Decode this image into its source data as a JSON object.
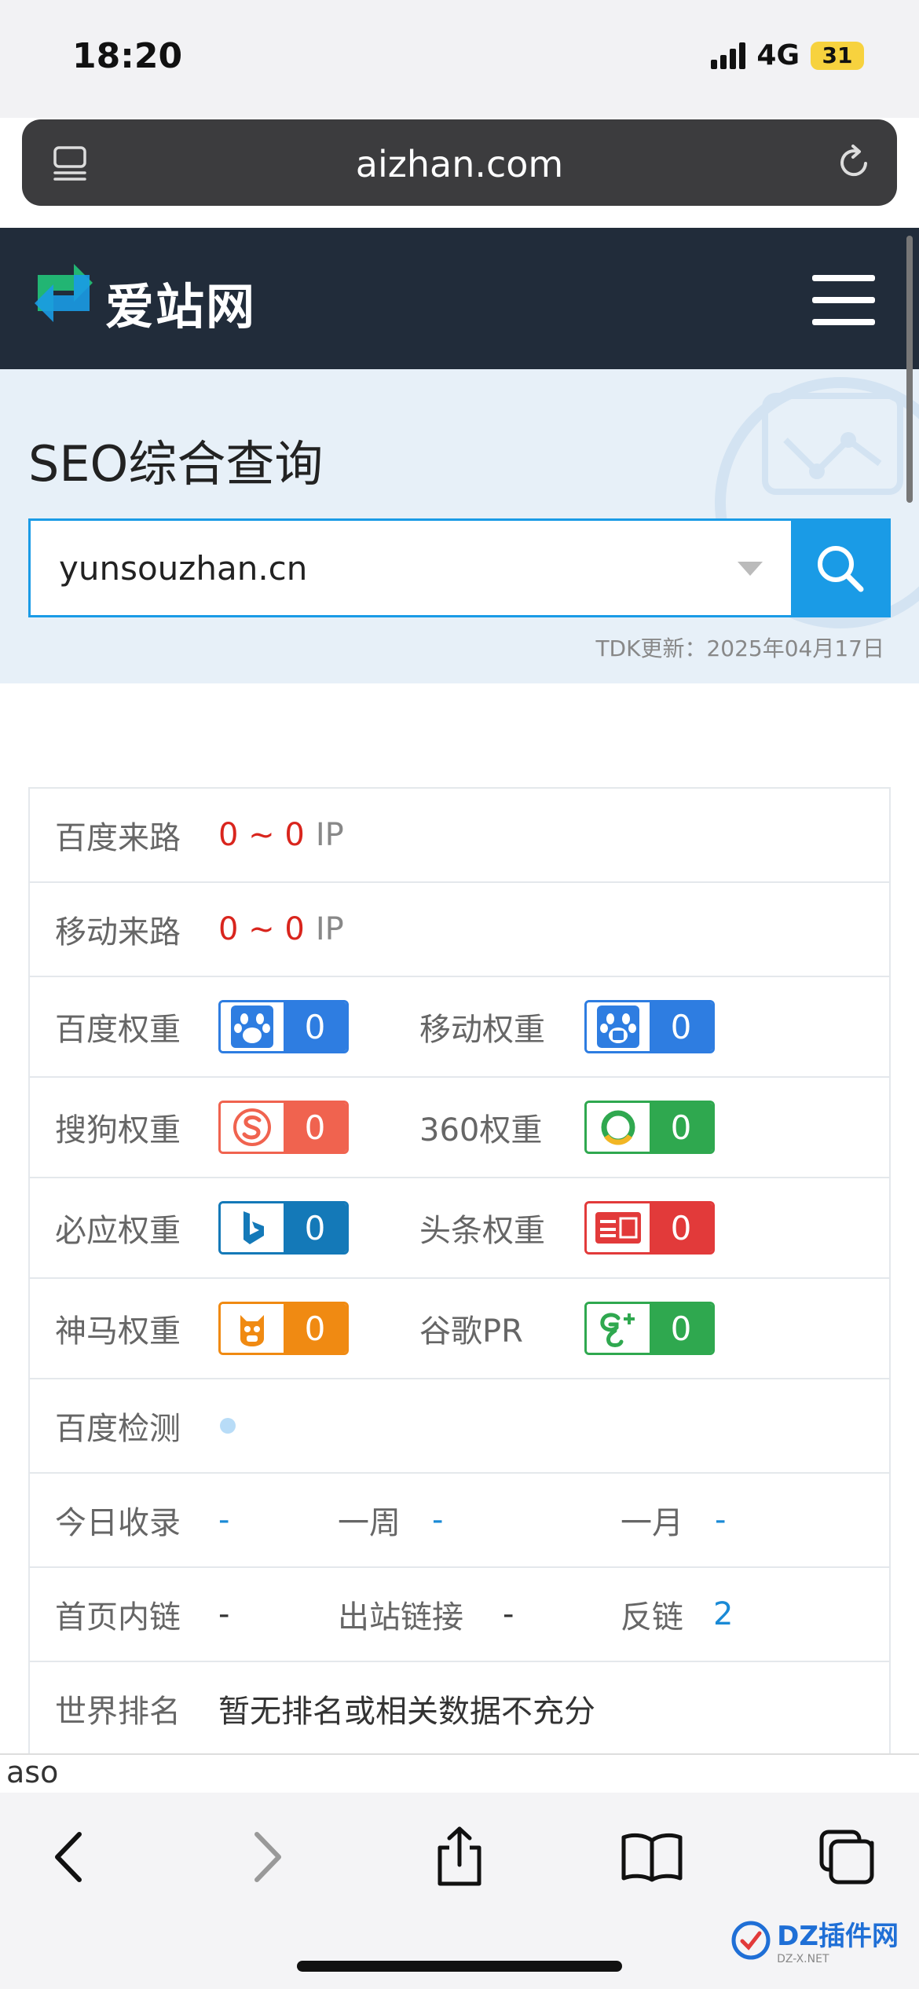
{
  "status": {
    "time": "18:20",
    "network": "4G",
    "battery": "31"
  },
  "browser": {
    "url": "aizhan.com"
  },
  "site": {
    "logo_text": "爱站网"
  },
  "hero": {
    "title": "SEO综合查询",
    "search_value": "yunsouzhan.cn",
    "tdk": "TDK更新：2025年04月17日"
  },
  "rows": {
    "baidu_traffic": {
      "label": "百度来路",
      "value": "0 ~ 0",
      "unit": "IP"
    },
    "mobile_traffic": {
      "label": "移动来路",
      "value": "0 ~ 0",
      "unit": "IP"
    },
    "baidu_weight": {
      "label": "百度权重",
      "value": "0"
    },
    "mobile_weight": {
      "label": "移动权重",
      "value": "0"
    },
    "sogou_weight": {
      "label": "搜狗权重",
      "value": "0"
    },
    "w360_weight": {
      "label": "360权重",
      "value": "0"
    },
    "bing_weight": {
      "label": "必应权重",
      "value": "0"
    },
    "toutiao_weight": {
      "label": "头条权重",
      "value": "0"
    },
    "shenma_weight": {
      "label": "神马权重",
      "value": "0"
    },
    "google_pr": {
      "label": "谷歌PR",
      "value": "0"
    },
    "baidu_check": {
      "label": "百度检测"
    },
    "index_today": {
      "label": "今日收录",
      "value": "-"
    },
    "index_week": {
      "label": "一周",
      "value": "-"
    },
    "index_month": {
      "label": "一月",
      "value": "-"
    },
    "home_inlinks": {
      "label": "首页内链",
      "value": "-"
    },
    "outlinks": {
      "label": "出站链接",
      "value": "-"
    },
    "backlinks": {
      "label": "反链",
      "value": "2"
    },
    "world_rank": {
      "label": "世界排名",
      "value": "暂无排名或相关数据不充分"
    }
  },
  "peek_text": "aso",
  "watermark": {
    "text": "DZ插件网",
    "sub": "DZ-X.NET"
  },
  "colors": {
    "header_bg": "#212c3a",
    "accent_blue": "#1a9be6",
    "baidu_blue": "#2e7de1",
    "sogou_red": "#f0634f",
    "g360_green": "#2fa84f",
    "bing_blue": "#1479b8",
    "toutiao_red": "#e23a3a",
    "shenma_orange": "#f08a12",
    "google_green": "#2fa84f"
  }
}
